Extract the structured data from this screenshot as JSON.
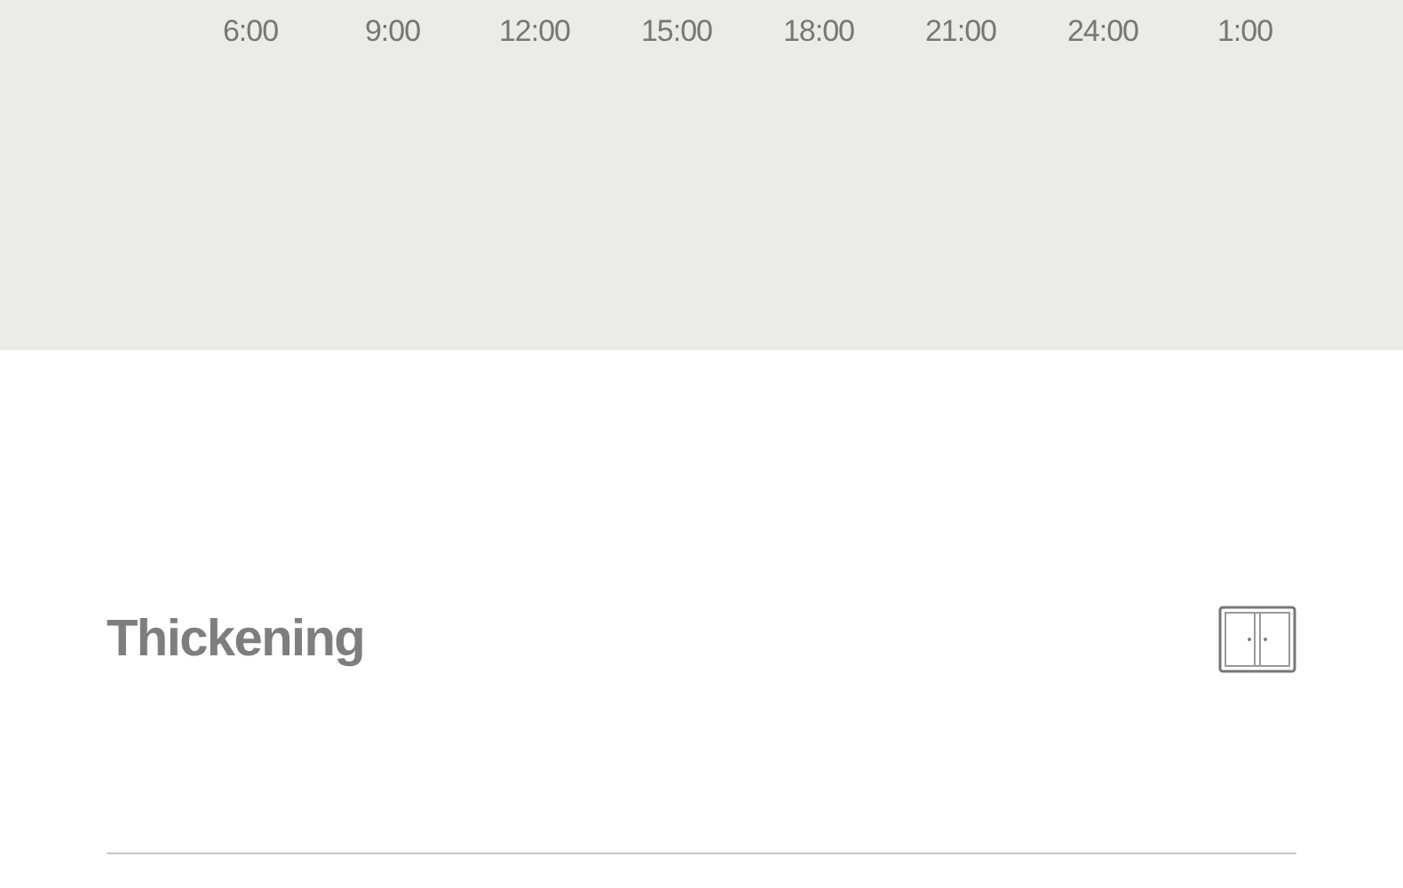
{
  "timeline": {
    "labels": [
      "6:00",
      "9:00",
      "12:00",
      "15:00",
      "18:00",
      "21:00",
      "24:00",
      "1:00"
    ]
  },
  "section": {
    "title": "Thickening"
  }
}
